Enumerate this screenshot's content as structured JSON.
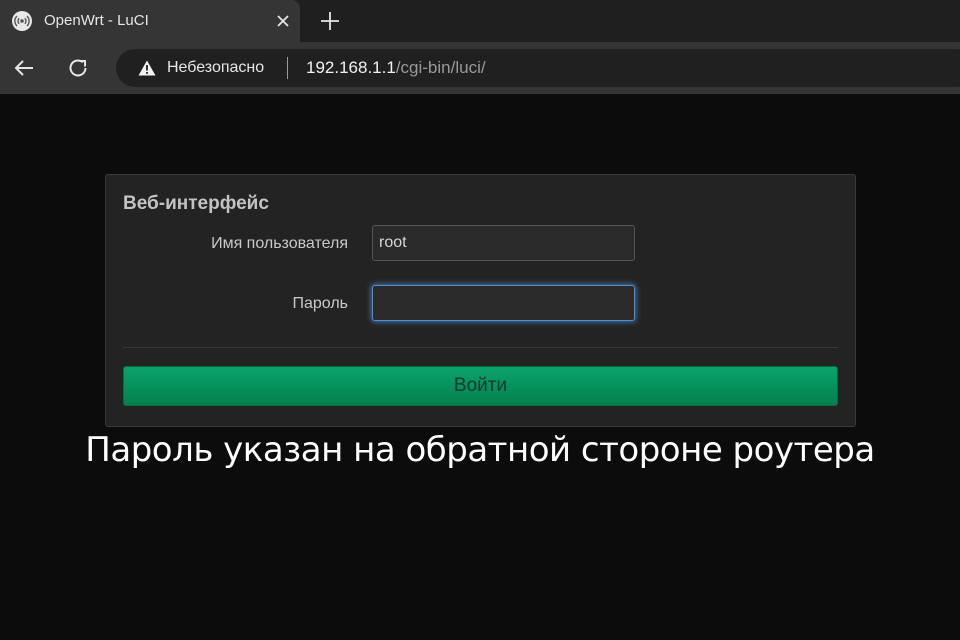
{
  "browser": {
    "tab_title": "OpenWrt - LuCI",
    "security_label": "Небезопасно",
    "url_host": "192.168.1.1",
    "url_path": "/cgi-bin/luci/"
  },
  "login": {
    "title": "Веб-интерфейс",
    "username_label": "Имя пользователя",
    "username_value": "root",
    "password_label": "Пароль",
    "password_value": "",
    "submit_label": "Войти"
  },
  "caption": "Пароль указан на обратной стороне роутера",
  "colors": {
    "accent_green": "#04945c",
    "focus_blue": "#4d8fd1",
    "page_background": "#0c0c0c"
  }
}
